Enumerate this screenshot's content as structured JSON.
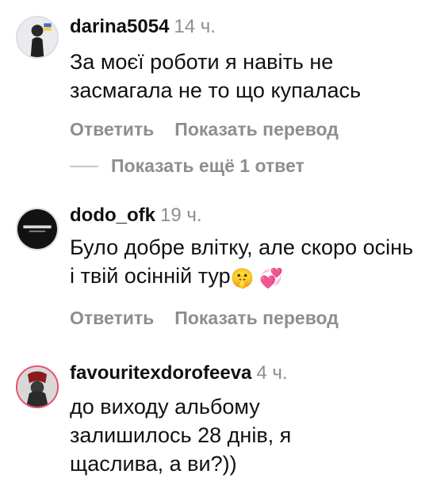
{
  "comments": [
    {
      "username": "darina5054",
      "time": "14 ч.",
      "text": "За моєї роботи я навіть не засмагала не то що купалась",
      "reply_label": "Ответить",
      "translate_label": "Показать перевод"
    },
    {
      "username": "dodo_ofk",
      "time": "19 ч.",
      "text": "Було добре влітку, але скоро осінь і твій осінній тур",
      "emoji": "🤫 💞",
      "reply_label": "Ответить",
      "translate_label": "Показать перевод"
    },
    {
      "username": "favouritexdorofeeva",
      "time": "4 ч.",
      "text": "до виходу альбому залишилось 28 днів, я щаслива, а ви?))"
    }
  ],
  "more_replies_label": "Показать ещё 1 ответ"
}
